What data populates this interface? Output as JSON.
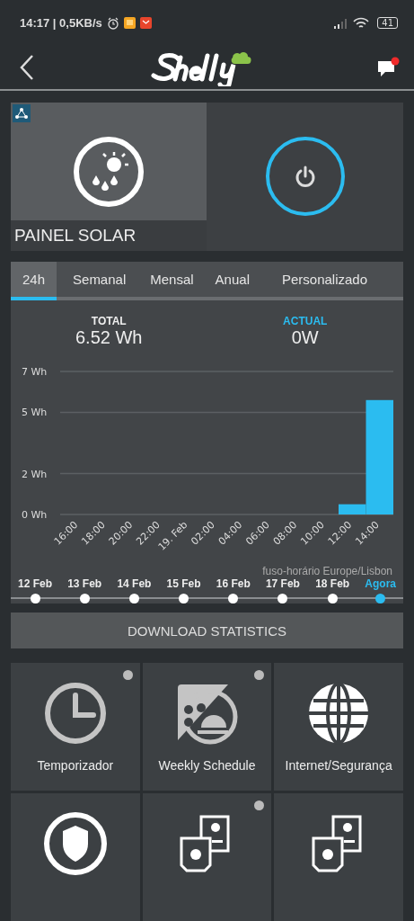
{
  "status_bar": {
    "time_speed": "14:17 | 0,5KB/s",
    "battery": "41"
  },
  "header": {
    "notification": true
  },
  "device": {
    "name": "PAINEL SOLAR",
    "on": true
  },
  "tabs": [
    {
      "label": "24h",
      "selected": true
    },
    {
      "label": "Semanal",
      "selected": false
    },
    {
      "label": "Mensal",
      "selected": false
    },
    {
      "label": "Anual",
      "selected": false
    },
    {
      "label": "Personalizado",
      "selected": false
    }
  ],
  "totals": [
    {
      "label": "TOTAL",
      "value": "6.52 Wh",
      "kind": "total"
    },
    {
      "label": "ACTUAL",
      "value": "0W",
      "kind": "actual"
    }
  ],
  "chart_data": {
    "type": "bar",
    "categories": [
      "16:00",
      "18:00",
      "20:00",
      "22:00",
      "19. Feb",
      "02:00",
      "04:00",
      "06:00",
      "08:00",
      "10:00",
      "12:00",
      "14:00"
    ],
    "series": [
      {
        "color": "#2bbcf0",
        "values": [
          null,
          null,
          null,
          null,
          null,
          null,
          null,
          null,
          null,
          null,
          0.5,
          5.6
        ]
      }
    ],
    "ylim": [
      0,
      7
    ],
    "yticks": [
      {
        "value": 0,
        "label": "0 Wh"
      },
      {
        "value": 2,
        "label": "2 Wh"
      },
      {
        "value": 5,
        "label": "5 Wh"
      },
      {
        "value": 7,
        "label": "7 Wh"
      }
    ]
  },
  "timezone": "fuso-horário Europe/Lisbon",
  "days": [
    {
      "label": "12 Feb",
      "selected": false
    },
    {
      "label": "13 Feb",
      "selected": false
    },
    {
      "label": "14 Feb",
      "selected": false
    },
    {
      "label": "15 Feb",
      "selected": false
    },
    {
      "label": "16 Feb",
      "selected": false
    },
    {
      "label": "17 Feb",
      "selected": false
    },
    {
      "label": "18 Feb",
      "selected": false
    },
    {
      "label": "Agora",
      "selected": true
    }
  ],
  "download_button": "DOWNLOAD STATISTICS",
  "tiles": [
    {
      "kind": "clock",
      "label": "Temporizador",
      "badge": true
    },
    {
      "kind": "schedule",
      "label": "Weekly Schedule",
      "badge": true
    },
    {
      "kind": "globe",
      "label": "Internet/Segurança",
      "badge": false
    },
    {
      "kind": "shield",
      "badge": false
    },
    {
      "kind": "cloud-devices",
      "badge": true
    },
    {
      "kind": "cloud-devices",
      "badge": false
    }
  ]
}
